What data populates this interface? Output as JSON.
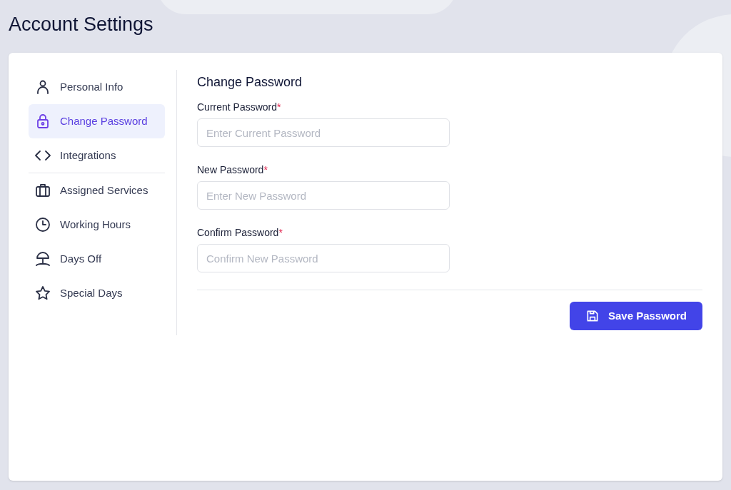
{
  "page_title": "Account Settings",
  "sidebar": {
    "groups": [
      [
        {
          "kind": "person",
          "label": "Personal Info",
          "selected": false
        },
        {
          "kind": "lock",
          "label": "Change Password",
          "selected": true
        },
        {
          "kind": "code",
          "label": "Integrations",
          "selected": false
        }
      ],
      [
        {
          "kind": "briefcase",
          "label": "Assigned Services",
          "selected": false
        },
        {
          "kind": "clock",
          "label": "Working Hours",
          "selected": false
        },
        {
          "kind": "umbrella",
          "label": "Days Off",
          "selected": false
        },
        {
          "kind": "star",
          "label": "Special Days",
          "selected": false
        }
      ]
    ]
  },
  "form": {
    "title": "Change Password",
    "fields": [
      {
        "label": "Current Password",
        "required_mark": "*",
        "placeholder": "Enter Current Password"
      },
      {
        "label": "New Password",
        "required_mark": "*",
        "placeholder": "Enter New Password"
      },
      {
        "label": "Confirm Password",
        "required_mark": "*",
        "placeholder": "Confirm New Password"
      }
    ],
    "save_button": "Save Password"
  }
}
